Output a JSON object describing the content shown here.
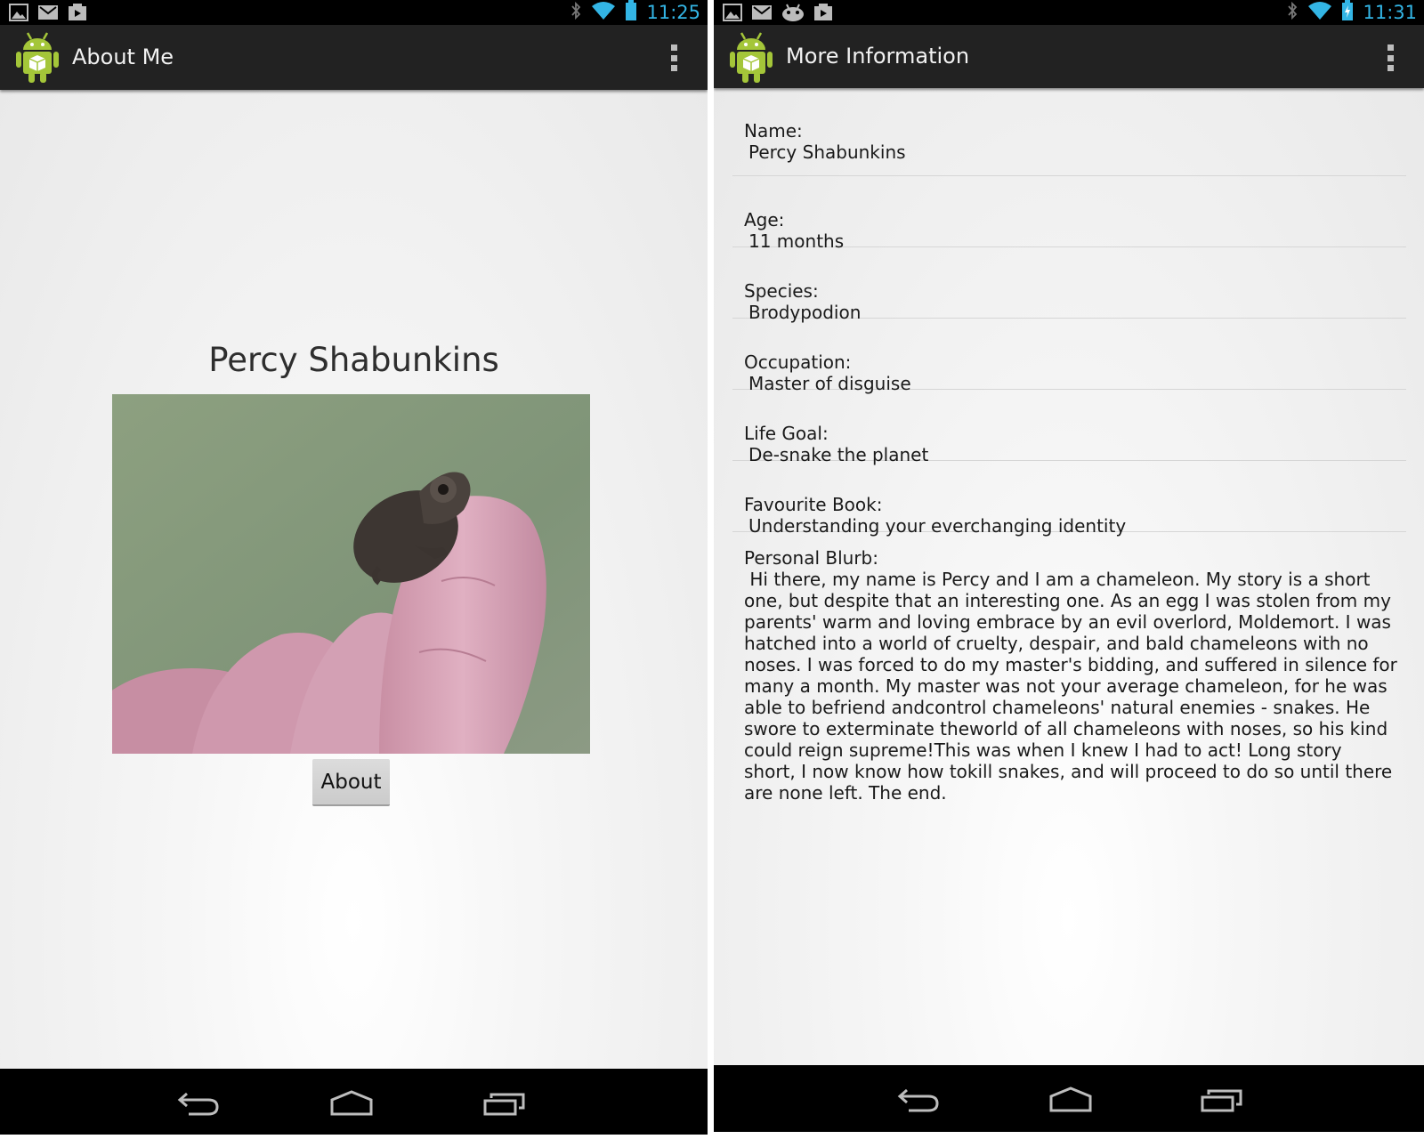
{
  "left_screen": {
    "status_bar": {
      "time": "11:25"
    },
    "action_bar": {
      "title": "About Me"
    },
    "main": {
      "name_heading": "Percy Shabunkins",
      "about_button_label": "About"
    }
  },
  "right_screen": {
    "status_bar": {
      "time": "11:31"
    },
    "action_bar": {
      "title": "More Information"
    },
    "fields": [
      {
        "label": "Name:",
        "value": "Percy Shabunkins"
      },
      {
        "label": "Age:",
        "value": "11 months"
      },
      {
        "label": "Species:",
        "value": "Brodypodion"
      },
      {
        "label": "Occupation:",
        "value": "Master of disguise"
      },
      {
        "label": "Life Goal:",
        "value": "De-snake the planet"
      },
      {
        "label": "Favourite Book:",
        "value": "Understanding your everchanging identity"
      }
    ],
    "blurb": {
      "label": "Personal Blurb:",
      "text": " Hi there, my name is Percy and I am a chameleon. My story is a short one, but despite that an interesting one. As an egg I was stolen from my parents' warm and loving embrace by an evil overlord, Moldemort. I was hatched into a world of cruelty, despair, and bald chameleons with no noses. I was forced to do my master's bidding, and suffered in silence for many a month. My master was not your average chameleon, for he was able to befriend andcontrol chameleons' natural enemies - snakes. He swore to exterminate theworld of all chameleons with noses, so his kind could reign supreme!This was when I knew I had to act! Long story short, I now know how tokill snakes, and will proceed to do so until there are none left. The end."
    }
  },
  "colors": {
    "clock": "#33b5e5",
    "action_bar": "#222222",
    "android_green": "#a4c639"
  },
  "icons": {
    "status_left": [
      "gallery-icon",
      "gmail-icon",
      "android-debug-icon",
      "play-store-icon"
    ],
    "status_right": [
      "bluetooth-icon",
      "wifi-icon",
      "battery-icon"
    ],
    "nav": [
      "back-icon",
      "home-icon",
      "recent-apps-icon"
    ]
  }
}
